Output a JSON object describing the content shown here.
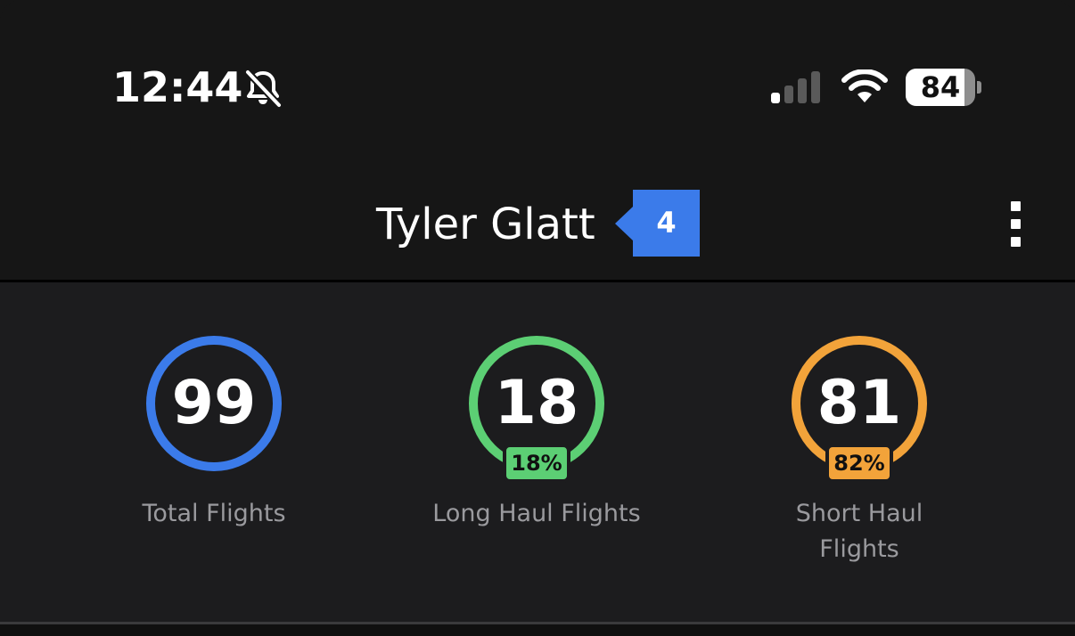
{
  "status_bar": {
    "time": "12:44",
    "battery_level": "84",
    "battery_fraction": 0.84,
    "signal_bars_active": 1,
    "signal_bars_total": 4,
    "icons": [
      "bell-off-icon",
      "signal-icon",
      "wifi-icon",
      "battery-icon"
    ]
  },
  "header": {
    "title": "Tyler Glatt",
    "badge": "4",
    "menu_icon": "more-vertical-icon"
  },
  "stats": [
    {
      "value": "99",
      "label": "Total Flights",
      "percent": "",
      "color": "#3b7bea"
    },
    {
      "value": "18",
      "label": "Long Haul Flights",
      "percent": "18%",
      "color": "#5ccf74"
    },
    {
      "value": "81",
      "label": "Short Haul\nFlights",
      "percent": "82%",
      "color": "#f2a33a"
    }
  ],
  "colors": {
    "background": "#161616",
    "panel": "#1c1c1e",
    "accent_blue": "#3b7bea",
    "green": "#5ccf74",
    "orange": "#f2a33a",
    "label_gray": "#9a9a9e"
  }
}
